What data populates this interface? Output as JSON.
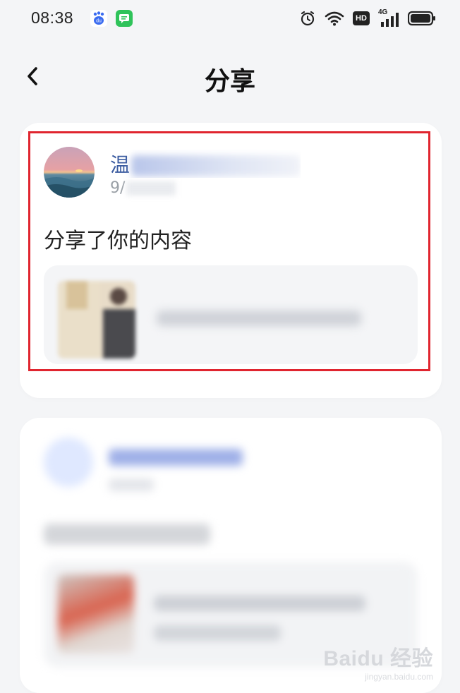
{
  "status_bar": {
    "time": "08:38",
    "icons": [
      "baidu-app-icon",
      "message-app-icon",
      "alarm-icon",
      "wifi-icon",
      "hd-icon",
      "4g-signal-icon",
      "battery-icon"
    ],
    "network_label": "4G",
    "hd_label": "HD"
  },
  "header": {
    "title": "分享",
    "back_icon": "chevron-left-icon"
  },
  "share_card_1": {
    "user_name_visible": "温",
    "time_visible": "9/",
    "share_text": "分享了你的内容"
  },
  "colors": {
    "background": "#f4f5f7",
    "card": "#ffffff",
    "highlight": "#e0252f",
    "user_name": "#3a5ba0"
  },
  "watermark": {
    "logo": "Baidu 经验",
    "url": "jingyan.baidu.com"
  }
}
